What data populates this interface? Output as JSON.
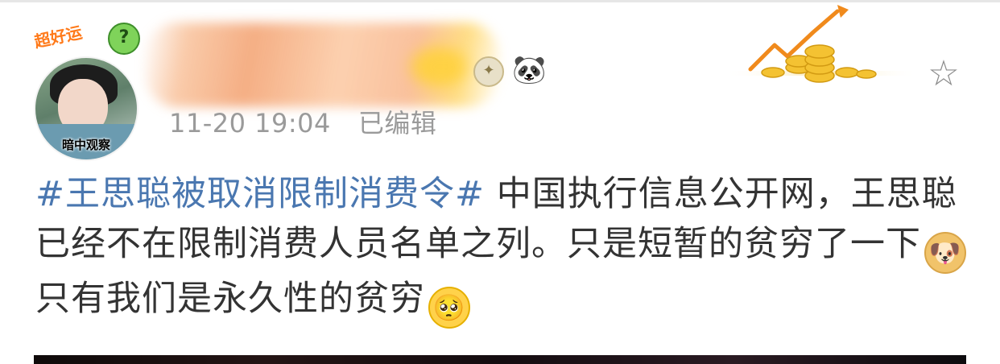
{
  "avatar": {
    "caption": "暗中观察",
    "sticker_text": "超好运",
    "badge_symbol": "?"
  },
  "post_meta": {
    "timestamp": "11-20 19:04",
    "edited_label": "已编辑"
  },
  "post": {
    "hashtag": "#王思聪被取消限制消费令#",
    "text_1": "中国执行信息公开网，王思聪已经不在限制消费人员名单之列。只是短暂的贫穷了一下",
    "emoji_1": "doge",
    "text_2": "只有我们是永久性的贫穷",
    "emoji_2": "sad"
  },
  "icons": {
    "favorite": "star-outline-icon",
    "panda": "panda-icon",
    "rank_badge": "rank-badge-icon"
  },
  "colors": {
    "hashtag": "#4a77b0",
    "body_text": "#333333",
    "meta_text": "#9a9a9a",
    "star": "#8d8d8d"
  }
}
